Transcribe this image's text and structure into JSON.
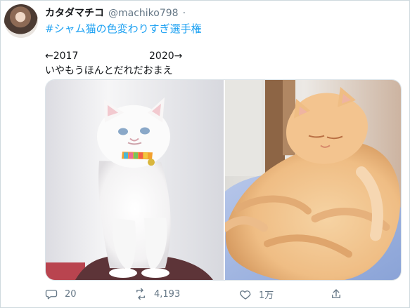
{
  "tweet": {
    "display_name": "カタダマチコ",
    "handle": "@machiko798",
    "dot": "·",
    "hashtag": "#シャム猫の色変わりすぎ選手権",
    "text": {
      "year_left": "←2017",
      "year_right": "2020→",
      "line_two": "いやもうほんとだれだおまえ"
    },
    "counts": {
      "replies": "20",
      "retweets": "4,193",
      "likes": "1万"
    }
  },
  "icons": {
    "avatar": "profile-photo",
    "reply": "reply-icon",
    "retweet": "retweet-icon",
    "like": "heart-icon",
    "share": "share-icon"
  },
  "colors": {
    "text": "#14171a",
    "secondary_text": "#657786",
    "link": "#1da1f2",
    "border": "#cfd9de"
  }
}
